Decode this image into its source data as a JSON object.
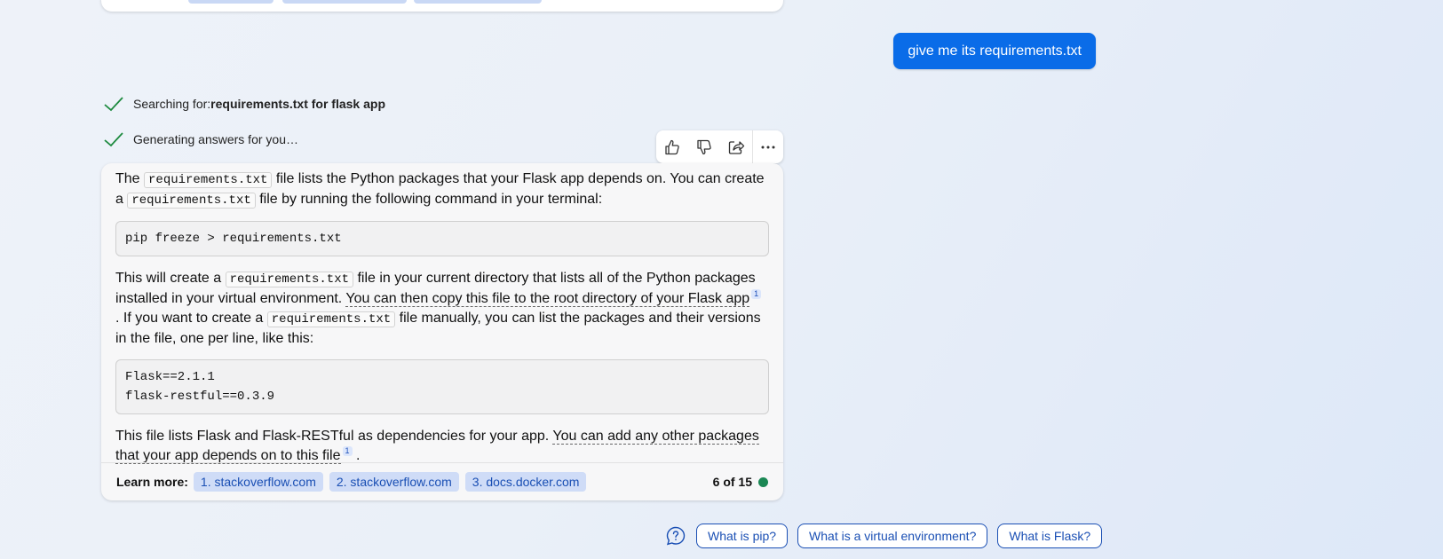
{
  "user_message": "give me its requirements.txt",
  "status": [
    {
      "label": "Searching for: ",
      "bold": "requirements.txt for flask app"
    },
    {
      "label": "Generating answers for you…",
      "bold": ""
    }
  ],
  "actions": [
    "thumbs-up-icon",
    "thumbs-down-icon",
    "share-icon",
    "more-icon"
  ],
  "answer": {
    "p1_a": "The ",
    "code_file": "requirements.txt",
    "p1_b": " file lists the Python packages that your Flask app depends on. You can create a ",
    "p1_c": " file by running the following command in your terminal:",
    "cmd": "pip freeze > requirements.txt",
    "p2_a": "This will create a ",
    "p2_b": " file in your current directory that lists all of the Python packages installed in your virtual environment. ",
    "p2_cite": "You can then copy this file to the root directory of your Flask app",
    "ref1": "1",
    "p2_c": " . If you want to create a ",
    "p2_d": " file manually, you can list the packages and their versions in the file, one per line, like this:",
    "code_lines": [
      "Flask==2.1.1",
      "flask-restful==0.3.9"
    ],
    "p3_a": "This file lists Flask and Flask-RESTful as dependencies for your app. ",
    "p3_cite": "You can add any other packages that your app depends on to this file",
    "p3_end": " ."
  },
  "learn_more": {
    "label": "Learn more:",
    "links": [
      "1. stackoverflow.com",
      "2. stackoverflow.com",
      "3. docs.docker.com"
    ],
    "count": "6 of 15",
    "status_color": "#1a8754"
  },
  "suggestions": [
    "What is pip?",
    "What is a virtual environment?",
    "What is Flask?"
  ],
  "colors": {
    "accent": "#0a6ce8",
    "link": "#1a4fb4"
  }
}
